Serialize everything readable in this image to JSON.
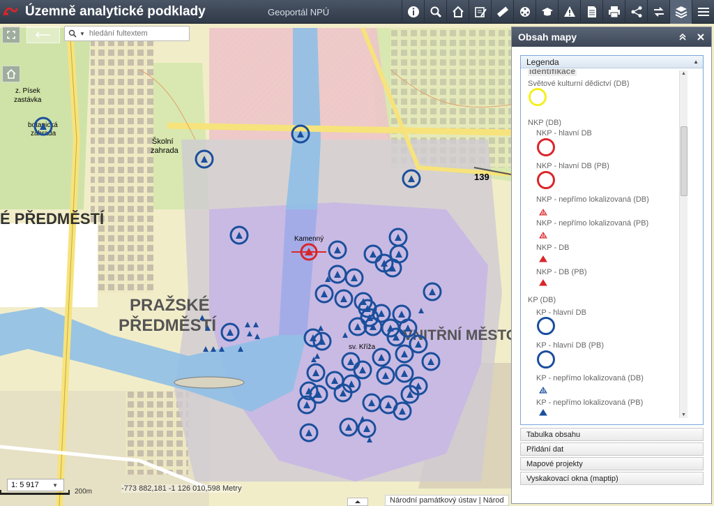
{
  "app": {
    "title": "Územně analytické podklady",
    "portal": "Geoportál NPÚ"
  },
  "toolbar": [
    {
      "icon": "info-icon"
    },
    {
      "icon": "search-icon"
    },
    {
      "icon": "home-icon"
    },
    {
      "icon": "edit-form-icon"
    },
    {
      "icon": "ruler-icon"
    },
    {
      "icon": "film-reel-icon"
    },
    {
      "icon": "graduation-cap-icon"
    },
    {
      "icon": "warning-icon"
    },
    {
      "icon": "document-icon"
    },
    {
      "icon": "print-icon"
    },
    {
      "icon": "share-icon"
    },
    {
      "icon": "swap-arrows-icon"
    },
    {
      "icon": "layers-icon"
    },
    {
      "icon": "menu-icon"
    }
  ],
  "search": {
    "placeholder": "hledání fultextem"
  },
  "map": {
    "labels": [
      {
        "text": "z. Písek",
        "k": "a"
      },
      {
        "text": "zastávka",
        "k": "b"
      },
      {
        "text": "botanická",
        "k": "c"
      },
      {
        "text": "zahrada",
        "k": "d"
      },
      {
        "text": "Školní",
        "k": "e"
      },
      {
        "text": "zahrada",
        "k": "f"
      },
      {
        "text": "É PŘEDMĚSTÍ",
        "k": "g"
      },
      {
        "text": "PRAŽSKÉ",
        "k": "h"
      },
      {
        "text": "PŘEDMĚSTÍ",
        "k": "i"
      },
      {
        "text": "VNITŘNÍ MĚSTO",
        "k": "j"
      },
      {
        "text": "139",
        "k": "k"
      },
      {
        "text": "Kamenný",
        "k": "l"
      },
      {
        "text": "sv. Kříža",
        "k": "m"
      }
    ],
    "scale": "1: 5 917",
    "scalebar_label": "200m",
    "coords": "-773 882,181 -1 126 010,598 Metry",
    "attribution": "Národní památkový ústav  |  Národ"
  },
  "panel": {
    "title": "Obsah mapy",
    "legend_tab": "Legenda",
    "legend": [
      {
        "label": "identifikace",
        "style": "ident"
      },
      {
        "label": "Světové kulturní dědictví (DB)",
        "symbol": "circle-yellow"
      },
      {
        "label": "NKP (DB)"
      },
      {
        "label": "NKP - hlavní DB",
        "symbol": "circle-red"
      },
      {
        "label": "NKP - hlavní DB (PB)",
        "symbol": "circle-red"
      },
      {
        "label": "NKP - nepřímo lokalizovaná (DB)",
        "symbol": "tri-red-hatched"
      },
      {
        "label": "NKP - nepřímo lokalizovaná (PB)",
        "symbol": "tri-red-hatched"
      },
      {
        "label": "NKP - DB",
        "symbol": "tri-red"
      },
      {
        "label": "NKP - DB (PB)",
        "symbol": "tri-red"
      },
      {
        "label": "KP (DB)"
      },
      {
        "label": "KP - hlavní DB",
        "symbol": "circle-blue"
      },
      {
        "label": "KP - hlavní DB (PB)",
        "symbol": "circle-blue"
      },
      {
        "label": "KP - nepřímo lokalizovaná (DB)",
        "symbol": "tri-blue-hatched"
      },
      {
        "label": "KP - nepřímo lokalizovaná (PB)",
        "symbol": "tri-blue"
      }
    ],
    "sections": [
      {
        "label": "Tabulka obsahu"
      },
      {
        "label": "Přidání dat"
      },
      {
        "label": "Mapové projekty"
      },
      {
        "label": "Vyskakovací okna (maptip)"
      }
    ]
  },
  "colors": {
    "header": "#3c4656",
    "kp_blue": "#1a4f9c",
    "nkp_red": "#d9262a",
    "world_heritage_yellow": "#f4ef1e",
    "river": "#7fb3de",
    "heritage_zone": "#c7b6e6"
  }
}
